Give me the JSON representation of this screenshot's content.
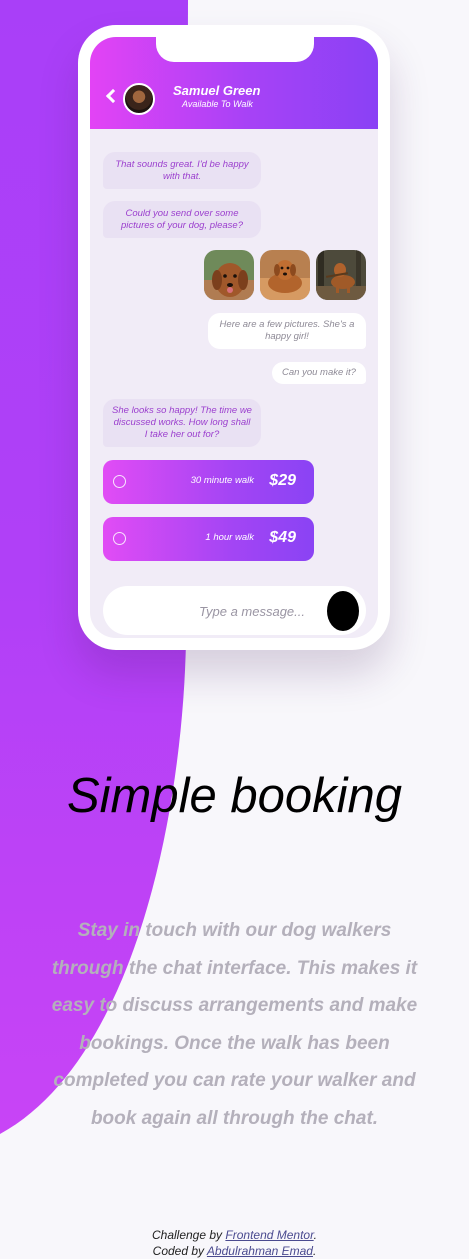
{
  "colors": {
    "accent_pink": "#e343f5",
    "accent_purple": "#8a41f5",
    "incoming_text": "#9b3fce",
    "muted_text": "#b4b0bb"
  },
  "chat": {
    "contact_name": "Samuel Green",
    "contact_status": "Available To Walk",
    "messages": [
      {
        "from": "walker",
        "text": "That sounds great. I'd be happy with that."
      },
      {
        "from": "walker",
        "text": "Could you send over some pictures of your dog, please?"
      },
      {
        "from": "owner",
        "text": "Here are a few pictures. She's a happy girl!"
      },
      {
        "from": "owner",
        "text": "Can you make it?"
      },
      {
        "from": "walker",
        "text": "She looks so happy! The time we discussed works. How long shall I take her out for?"
      }
    ],
    "photos": [
      "dog-photo",
      "dog-photo",
      "dog-photo"
    ],
    "offers": [
      {
        "label": "30 minute walk",
        "price": "$29"
      },
      {
        "label": "1 hour walk",
        "price": "$49"
      }
    ],
    "composer_placeholder": "Type a message..."
  },
  "section": {
    "title": "Simple booking",
    "description": "Stay in touch with our dog walkers through the chat interface. This makes it easy to discuss arrangements and make bookings. Once the walk has been completed you can rate your walker and book again all through the chat."
  },
  "attribution": {
    "challenge_prefix": "Challenge by",
    "challenge_link": "Frontend Mentor",
    "coded_prefix": "Coded by",
    "coded_link": "Abdulrahman Emad"
  }
}
